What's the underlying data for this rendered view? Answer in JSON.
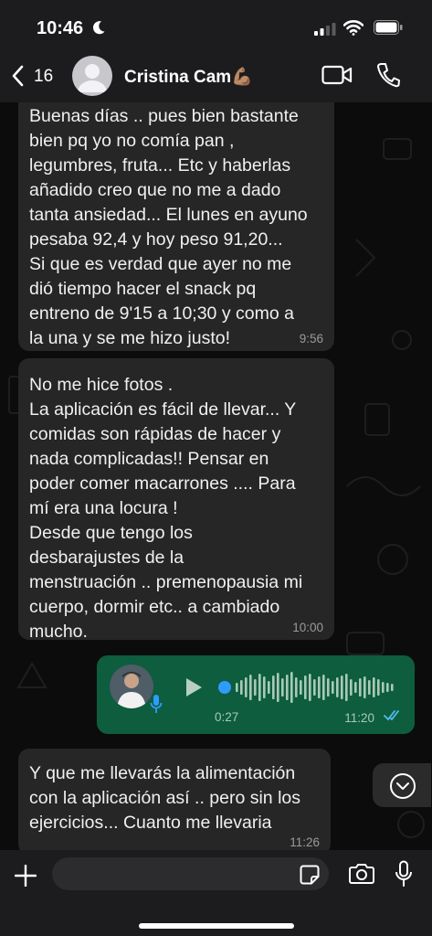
{
  "status_bar": {
    "time": "10:46"
  },
  "header": {
    "back_count": "16",
    "contact_name": "Cristina Cam💪🏽"
  },
  "messages": [
    {
      "direction": "incoming",
      "text": "Buenas  días .. pues bien bastante\nbien pq yo no comía pan ,\nlegumbres, fruta... Etc y haberlas\nañadido creo que no me a dado\ntanta ansiedad... El lunes en ayuno\npesaba 92,4 y hoy peso 91,20...\nSi que es verdad que ayer no me\ndió tiempo hacer el snack pq\nentreno de 9'15 a 10;30 y como a\nla una y se me hizo justo!",
      "time": "9:56"
    },
    {
      "direction": "incoming",
      "text": "No me hice fotos .\nLa aplicación es fácil de llevar... Y\ncomidas son rápidas de hacer y\nnada complicadas!! Pensar en\npoder comer macarrones .... Para\nmí era una locura !\nDesde que tengo los\ndesbarajustes de la\nmenstruación .. premenopausia mi\ncuerpo, dormir etc.. a cambiado\nmucho.",
      "time": "10:00"
    },
    {
      "direction": "outgoing",
      "type": "voice",
      "duration": "0:27",
      "time": "11:20",
      "progress": 0
    },
    {
      "direction": "incoming",
      "text": "Y que me llevarás la alimentación\ncon la aplicación así .. pero sin los\nejercicios... Cuanto me llevaria",
      "time": "11:26"
    }
  ],
  "composer": {
    "placeholder": ""
  },
  "colors": {
    "incoming_bubble": "#262626",
    "outgoing_bubble": "#0d5d3e",
    "read_ticks": "#53bdeb",
    "voice_dot": "#2f9bff"
  },
  "icons": [
    "moon-icon",
    "signal-icon",
    "wifi-icon",
    "battery-icon",
    "back-icon",
    "video-call-icon",
    "phone-icon",
    "play-icon",
    "mic-icon",
    "chevron-down-icon",
    "plus-icon",
    "sticker-icon",
    "camera-icon",
    "double-check-icon"
  ]
}
